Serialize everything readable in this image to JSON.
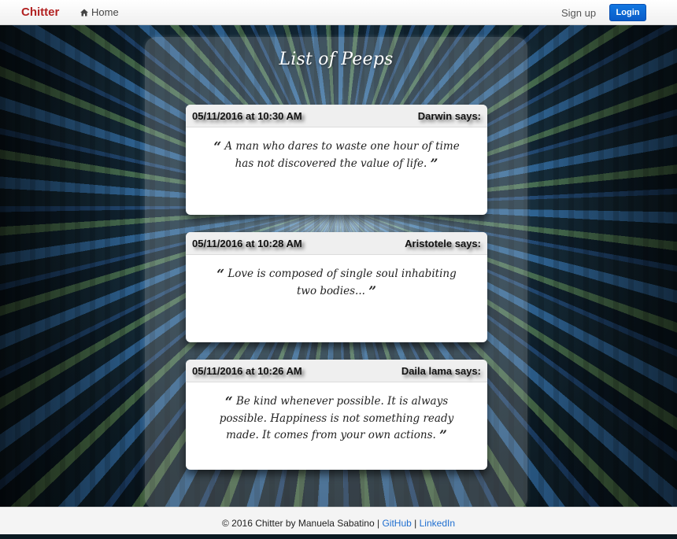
{
  "navbar": {
    "brand": "Chitter",
    "home_label": "Home",
    "signup_label": "Sign up",
    "login_label": "Login"
  },
  "main": {
    "title": "List of Peeps"
  },
  "peeps": [
    {
      "date": "05/11/2016 at 10:30 AM",
      "author": "Darwin says:",
      "text": "A man who dares to waste one hour of time has not discovered the value of life."
    },
    {
      "date": "05/11/2016 at 10:28 AM",
      "author": "Aristotele says:",
      "text": "Love is composed of single soul inhabiting two bodies..."
    },
    {
      "date": "05/11/2016 at 10:26 AM",
      "author": "Daila lama says:",
      "text": "Be kind whenever possible. It is always possible. Happiness is not something ready made. It comes from your own actions."
    }
  ],
  "quotes": {
    "open": "“",
    "close": "”"
  },
  "footer": {
    "copyright": "© 2016 Chitter by Manuela Sabatino",
    "sep": "|",
    "github_label": "GitHub",
    "linkedin_label": "LinkedIn"
  },
  "colors": {
    "brand": "#b22222",
    "login_button": "#0a5cc8",
    "link": "#1f6fd0"
  }
}
